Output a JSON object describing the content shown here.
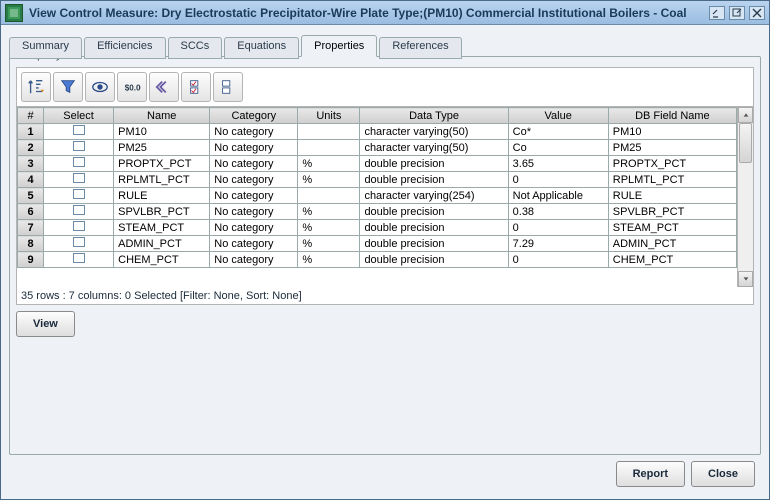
{
  "titlebar": {
    "title": "View Control Measure: Dry Electrostatic Precipitator-Wire Plate Type;(PM10) Commercial Institutional Boilers - Coal"
  },
  "tabs": [
    "Summary",
    "Efficiencies",
    "SCCs",
    "Equations",
    "Properties",
    "References"
  ],
  "active_tab": 4,
  "fieldset_title": "Property",
  "columns": [
    "#",
    "Select",
    "Name",
    "Category",
    "Units",
    "Data Type",
    "Value",
    "DB Field Name"
  ],
  "rows": [
    {
      "n": "1",
      "name": "PM10",
      "category": "No category",
      "units": "",
      "datatype": "character varying(50)",
      "value": "Co*",
      "dbfield": "PM10"
    },
    {
      "n": "2",
      "name": "PM25",
      "category": "No category",
      "units": "",
      "datatype": "character varying(50)",
      "value": "Co",
      "dbfield": "PM25"
    },
    {
      "n": "3",
      "name": "PROPTX_PCT",
      "category": "No category",
      "units": "%",
      "datatype": "double precision",
      "value": "3.65",
      "dbfield": "PROPTX_PCT"
    },
    {
      "n": "4",
      "name": "RPLMTL_PCT",
      "category": "No category",
      "units": "%",
      "datatype": "double precision",
      "value": "0",
      "dbfield": "RPLMTL_PCT"
    },
    {
      "n": "5",
      "name": "RULE",
      "category": "No category",
      "units": "",
      "datatype": "character varying(254)",
      "value": "Not Applicable",
      "dbfield": "RULE"
    },
    {
      "n": "6",
      "name": "SPVLBR_PCT",
      "category": "No category",
      "units": "%",
      "datatype": "double precision",
      "value": "0.38",
      "dbfield": "SPVLBR_PCT"
    },
    {
      "n": "7",
      "name": "STEAM_PCT",
      "category": "No category",
      "units": "%",
      "datatype": "double precision",
      "value": "0",
      "dbfield": "STEAM_PCT"
    },
    {
      "n": "8",
      "name": "ADMIN_PCT",
      "category": "No category",
      "units": "%",
      "datatype": "double precision",
      "value": "7.29",
      "dbfield": "ADMIN_PCT"
    },
    {
      "n": "9",
      "name": "CHEM_PCT",
      "category": "No category",
      "units": "%",
      "datatype": "double precision",
      "value": "0",
      "dbfield": "CHEM_PCT"
    }
  ],
  "status": "35 rows : 7 columns: 0 Selected [Filter: None, Sort: None]",
  "buttons": {
    "view": "View",
    "report": "Report",
    "close": "Close"
  }
}
